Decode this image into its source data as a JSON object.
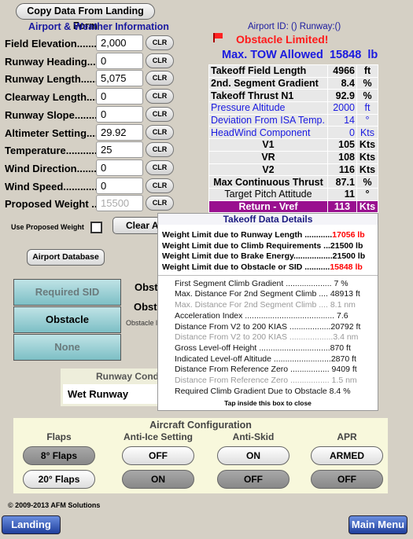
{
  "copy_button": "Copy Data From Landing Form",
  "section_title": "Airport & Weather Information",
  "fields": [
    {
      "label": "Field Elevation........",
      "value": "2,000"
    },
    {
      "label": "Runway Heading.....",
      "value": "0"
    },
    {
      "label": "Runway Length.......",
      "value": "5,075"
    },
    {
      "label": "Clearway Length.....",
      "value": "0"
    },
    {
      "label": "Runway Slope.........",
      "value": "0"
    },
    {
      "label": "Altimeter Setting.....",
      "value": "29.92"
    },
    {
      "label": "Temperature............",
      "value": "25"
    },
    {
      "label": "Wind Direction........",
      "value": "0"
    },
    {
      "label": "Wind Speed.............",
      "value": "0"
    },
    {
      "label": "Proposed Weight ...",
      "value": "",
      "placeholder": "15500"
    }
  ],
  "clr_label": "CLR",
  "use_proposed_weight": "Use Proposed Weight",
  "use_proposed_checked": false,
  "clear_all": "Clear All",
  "airport_database": "Airport Database",
  "sid_options": [
    "Required SID Gradient",
    "Obstacle",
    "None"
  ],
  "sid_selected": "Obstacle",
  "obstacle_labels": [
    "Obst",
    "Obsta",
    "Obstacle l"
  ],
  "runway_condition": {
    "title": "Runway Condi",
    "value": "Wet Runway"
  },
  "airport_info": "Airport ID: () Runway:()",
  "status": "Obstacle Limited!",
  "flag_icon": "red-flag-icon",
  "max_tow": {
    "label": "Max. TOW Allowed",
    "value": "15848",
    "unit": "lb"
  },
  "results": [
    {
      "label": "Takeoff Field Length",
      "value": "4966",
      "unit": "ft",
      "style": "bold"
    },
    {
      "label": "2nd. Segment Gradient",
      "value": "8.4",
      "unit": "%",
      "style": "bold"
    },
    {
      "label": "Takeoff Thrust N1",
      "value": "92.9",
      "unit": "%",
      "style": "bold"
    },
    {
      "label": "Pressure Altitude",
      "value": "2000",
      "unit": "ft",
      "style": "blue"
    },
    {
      "label": "Deviation From ISA Temp.",
      "value": "14",
      "unit": "°",
      "style": "blue"
    },
    {
      "label": "HeadWind Component",
      "value": "0",
      "unit": "Kts",
      "style": "blue"
    },
    {
      "label": "V1",
      "value": "105",
      "unit": "Kts",
      "style": "center"
    },
    {
      "label": "VR",
      "value": "108",
      "unit": "Kts",
      "style": "center"
    },
    {
      "label": "V2",
      "value": "116",
      "unit": "Kts",
      "style": "center"
    },
    {
      "label": "Max Continuous Thrust",
      "value": "87.1",
      "unit": "%",
      "style": "center"
    },
    {
      "label": "Target Pitch Attitude",
      "value": "11",
      "unit": "°",
      "style": "plain"
    },
    {
      "label": "Return - Vref",
      "value": "113",
      "unit": "Kts",
      "style": "purple"
    }
  ],
  "details": {
    "title": "Takeoff Data Details",
    "limits": [
      {
        "label": "Weight Limit due to Runway Length ............",
        "value": "17056 lb",
        "red": true
      },
      {
        "label": "Weight Limit due to Climb Requirements ...",
        "value": "21500 lb",
        "red": false
      },
      {
        "label": "Weight Limit due to Brake Energy.................",
        "value": "21500 lb",
        "red": false
      },
      {
        "label": "Weight Limit due to Obstacle or SID ...........",
        "value": "15848 lb",
        "red": true
      }
    ],
    "items": [
      {
        "text": "First Segment Climb Gradient .................... 7  %",
        "grey": false
      },
      {
        "text": "Max. Distance For 2nd Segment Climb .... 48913  ft",
        "grey": false
      },
      {
        "text": "Max. Distance For 2nd Segment Climb .... 8.1  nm",
        "grey": true
      },
      {
        "text": "Acceleration Index ....................................... 7.6",
        "grey": false
      },
      {
        "text": "Distance From V2 to 200 KIAS ..................20792 ft",
        "grey": false
      },
      {
        "text": "Distance From V2 to 200 KIAS ...................3.4 nm",
        "grey": true
      },
      {
        "text": "Gross Level-off Height ...............................870 ft",
        "grey": false
      },
      {
        "text": "Indicated Level-off Altitude .........................2870 ft",
        "grey": false
      },
      {
        "text": "Distance From Reference Zero ................. 9409 ft",
        "grey": false
      },
      {
        "text": "Distance From Reference Zero ................. 1.5 nm",
        "grey": true
      },
      {
        "text": "Required Climb Gradient Due to Obstacle  8.4 %",
        "grey": false
      }
    ],
    "close_hint": "Tap inside this box to close"
  },
  "config": {
    "title": "Aircraft Configuration",
    "groups": [
      {
        "label": "Flaps",
        "options": [
          "8° Flaps",
          "20° Flaps"
        ],
        "selected": 0
      },
      {
        "label": "Anti-Ice Setting",
        "options": [
          "OFF",
          "ON"
        ],
        "selected": 0
      },
      {
        "label": "Anti-Skid",
        "options": [
          "ON",
          "OFF"
        ],
        "selected": 0
      },
      {
        "label": "APR",
        "options": [
          "ARMED",
          "OFF"
        ],
        "selected": 0
      }
    ]
  },
  "copyright": "© 2009-2013 AFM Solutions",
  "nav": {
    "landing": "Landing",
    "main_menu": "Main Menu"
  },
  "colors": {
    "background": "#d5d0c5",
    "title_blue": "#1a1aa0",
    "alert_red": "#ff1a1a",
    "vref_purple": "#99108f",
    "panel_yellow": "#f8f8dc"
  }
}
